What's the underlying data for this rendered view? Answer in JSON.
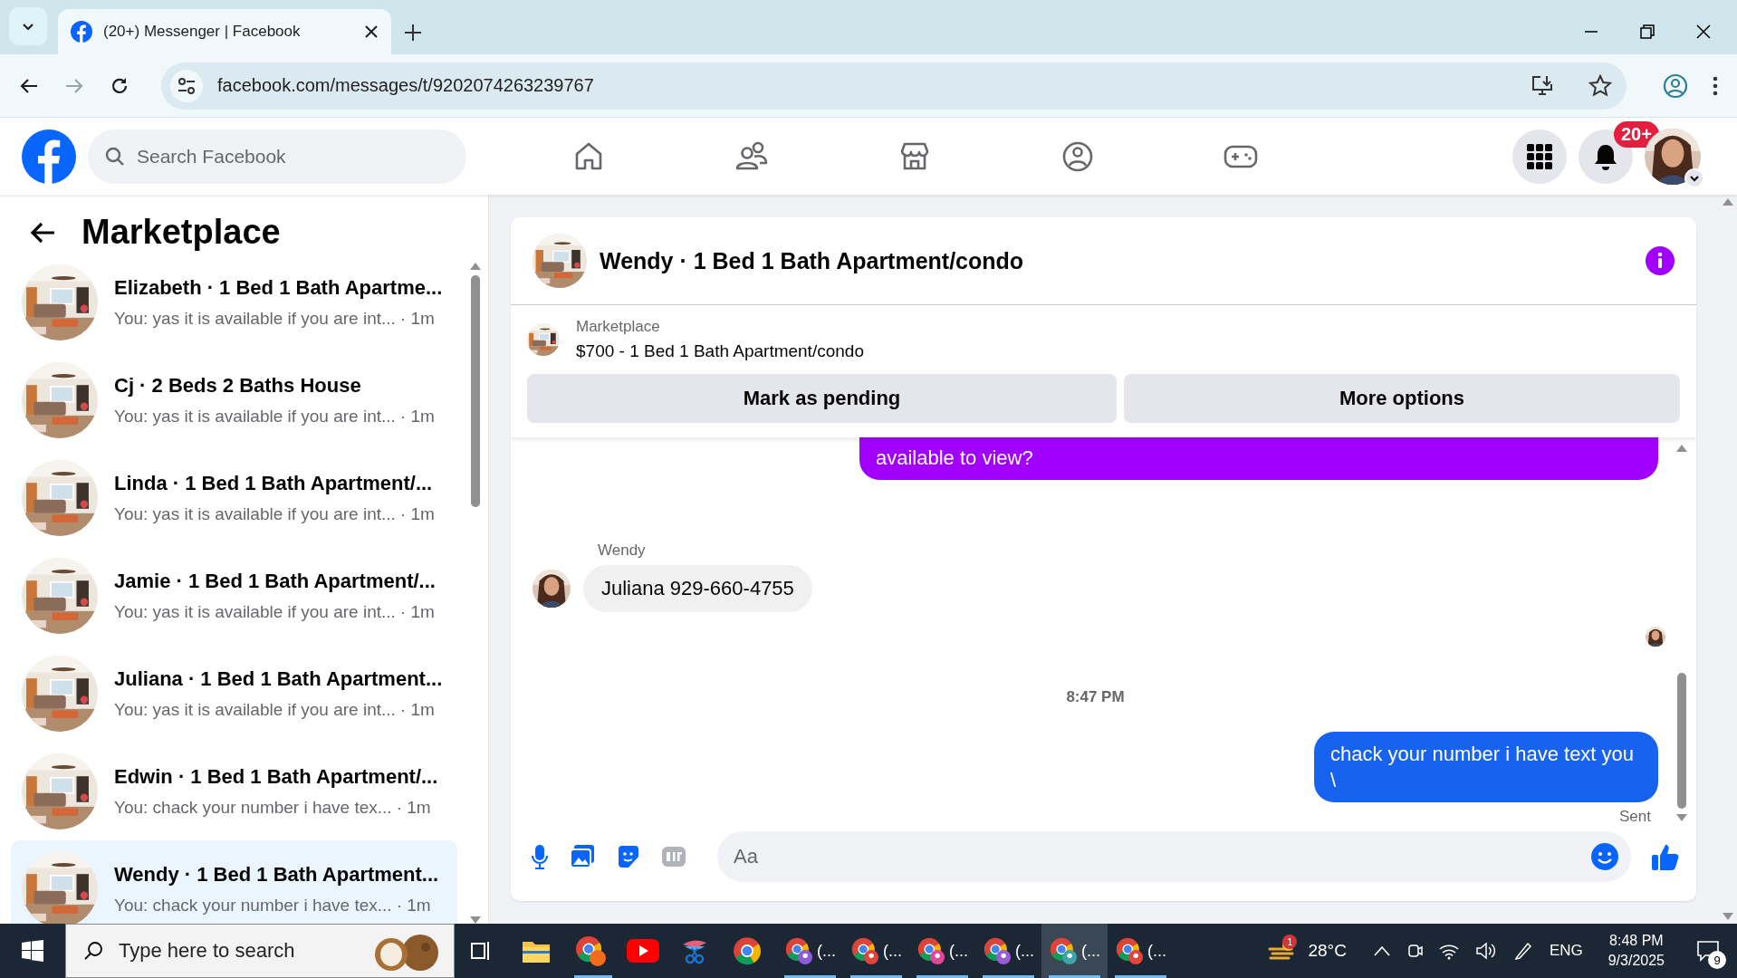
{
  "browser": {
    "tab_title": "(20+) Messenger | Facebook",
    "url": "facebook.com/messages/t/9202074263239767"
  },
  "header": {
    "search": {
      "placeholder": "Search Facebook"
    },
    "notification_badge": "20+"
  },
  "sidebar": {
    "title": "Marketplace",
    "conversations": [
      {
        "title": "Elizabeth · 1 Bed 1 Bath Apartme...",
        "preview": "You: yas it is available if you are int...",
        "time": "· 1m",
        "selected": false
      },
      {
        "title": "Cj · 2 Beds 2 Baths House",
        "preview": "You: yas it is available if you are int...",
        "time": "· 1m",
        "selected": false
      },
      {
        "title": "Linda · 1 Bed 1 Bath Apartment/...",
        "preview": "You: yas it is available if you are int...",
        "time": "· 1m",
        "selected": false
      },
      {
        "title": "Jamie · 1 Bed 1 Bath Apartment/...",
        "preview": "You: yas it is available if you are int...",
        "time": "· 1m",
        "selected": false
      },
      {
        "title": "Juliana · 1 Bed 1 Bath Apartment...",
        "preview": "You: yas it is available if you are int...",
        "time": "· 1m",
        "selected": false
      },
      {
        "title": "Edwin · 1 Bed 1 Bath Apartment/...",
        "preview": "You: chack your number i have tex...",
        "time": "· 1m",
        "selected": false
      },
      {
        "title": "Wendy · 1 Bed 1 Bath Apartment...",
        "preview": "You: chack your number i have tex...",
        "time": "· 1m",
        "selected": true
      }
    ]
  },
  "chat": {
    "title": "Wendy · 1 Bed 1 Bath Apartment/condo",
    "listing": {
      "label": "Marketplace",
      "price_title": "$700 - 1 Bed 1 Bath Apartment/condo"
    },
    "buttons": [
      "Mark as pending",
      "More options"
    ],
    "messages": [
      {
        "kind": "outgoing",
        "text": "available to view?",
        "color": "#a100ff"
      },
      {
        "kind": "incoming",
        "sender": "Wendy",
        "text": "Juliana 929-660-4755"
      },
      {
        "kind": "receipt"
      },
      {
        "kind": "timestamp",
        "text": "8:47 PM"
      },
      {
        "kind": "outgoing",
        "text": "chack your number i have text you \\",
        "color": "#1763f0",
        "status": "Sent"
      }
    ],
    "composer": {
      "placeholder": "Aa"
    }
  },
  "taskbar": {
    "search": {
      "placeholder": "Type here to search"
    },
    "apps": [
      {
        "kind": "task-view",
        "running": false,
        "selected": false
      },
      {
        "kind": "explorer",
        "running": false,
        "selected": false
      },
      {
        "kind": "chrome-badge",
        "running": true,
        "selected": false
      },
      {
        "kind": "youtube",
        "running": false,
        "selected": false
      },
      {
        "kind": "snip",
        "running": false,
        "selected": false
      },
      {
        "kind": "chrome",
        "running": false,
        "selected": false
      },
      {
        "kind": "chrome-profile",
        "label": "(...",
        "color": "#8e5bd6",
        "running": true,
        "selected": false
      },
      {
        "kind": "chrome-profile",
        "label": "(...",
        "color": "#e0443a",
        "running": true,
        "selected": false
      },
      {
        "kind": "chrome-profile",
        "label": "(...",
        "color": "#e0469a",
        "running": true,
        "selected": false
      },
      {
        "kind": "chrome-profile",
        "label": "(...",
        "color": "#9a5bd6",
        "running": true,
        "selected": false
      },
      {
        "kind": "chrome-profile",
        "label": "(...",
        "color": "#3fa3a8",
        "running": true,
        "selected": true
      },
      {
        "kind": "chrome-profile",
        "label": "(...",
        "color": "#e0443a",
        "running": true,
        "selected": false
      }
    ],
    "weather": {
      "badge": "1",
      "temperature": "28°C"
    },
    "language": "ENG",
    "time": "8:48 PM",
    "date": "9/3/2025",
    "notifications": "9"
  }
}
